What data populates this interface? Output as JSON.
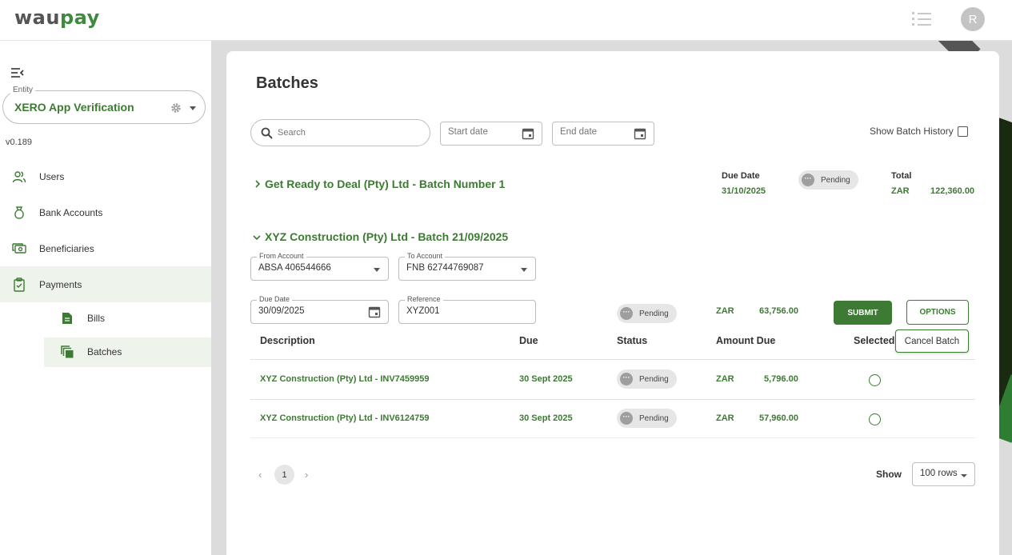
{
  "header": {
    "logo_part1": "wau",
    "logo_part2": "pay",
    "avatar_initial": "R"
  },
  "sidebar": {
    "entity_label": "Entity",
    "entity_name": "XERO App Verification",
    "version": "v0.189",
    "items": [
      {
        "label": "Users",
        "icon": "users-icon"
      },
      {
        "label": "Bank Accounts",
        "icon": "money-bag-icon"
      },
      {
        "label": "Beneficiaries",
        "icon": "cash-icon"
      },
      {
        "label": "Payments",
        "icon": "clipboard-check-icon",
        "active": true
      }
    ],
    "sub_items": [
      {
        "label": "Bills",
        "icon": "document-icon"
      },
      {
        "label": "Batches",
        "icon": "copy-icon",
        "active": true
      }
    ]
  },
  "page": {
    "title": "Batches",
    "search_placeholder": "Search",
    "start_date_placeholder": "Start date",
    "end_date_placeholder": "End date",
    "show_history_label": "Show Batch History"
  },
  "batch1": {
    "title": "Get Ready to Deal (Pty) Ltd - Batch Number 1",
    "due_date_label": "Due Date",
    "due_date": "31/10/2025",
    "status": "Pending",
    "total_label": "Total",
    "currency": "ZAR",
    "total": "122,360.00"
  },
  "batch2": {
    "title": "XYZ Construction (Pty) Ltd - Batch 21/09/2025",
    "from_account_label": "From Account",
    "from_account": "ABSA 406544666",
    "to_account_label": "To Account",
    "to_account": "FNB 62744769087",
    "due_date_label": "Due Date",
    "due_date": "30/09/2025",
    "reference_label": "Reference",
    "reference": "XYZ001",
    "status": "Pending",
    "currency": "ZAR",
    "amount": "63,756.00",
    "submit_label": "SUBMIT",
    "options_label": "OPTIONS",
    "cancel_batch_label": "Cancel Batch",
    "columns": [
      "Description",
      "Due",
      "Status",
      "Amount Due",
      "Selected"
    ],
    "rows": [
      {
        "description": "XYZ Construction (Pty) Ltd - INV7459959",
        "due": "30 Sept 2025",
        "status": "Pending",
        "currency": "ZAR",
        "amount": "5,796.00"
      },
      {
        "description": "XYZ Construction (Pty) Ltd - INV6124759",
        "due": "30 Sept 2025",
        "status": "Pending",
        "currency": "ZAR",
        "amount": "57,960.00"
      }
    ]
  },
  "pagination": {
    "prev": "‹",
    "page": "1",
    "next": "›",
    "show_label": "Show",
    "rows_value": "100 rows"
  },
  "colors": {
    "brand_green": "#3d7a33",
    "active_bg": "#eef4ec"
  }
}
